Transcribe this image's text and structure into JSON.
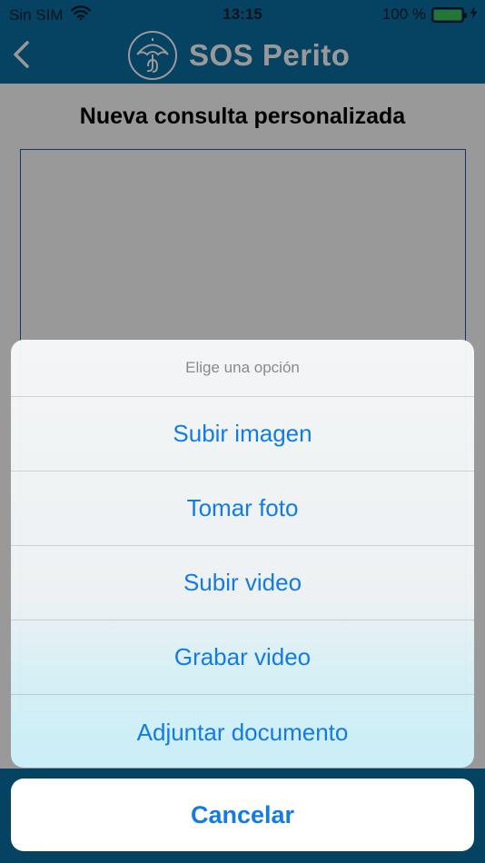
{
  "status_bar": {
    "carrier": "Sin SIM",
    "time": "13:15",
    "battery": "100 %",
    "battery_level": 1.0
  },
  "nav": {
    "title": "SOS Perito",
    "back_icon": "chevron-left-icon",
    "logo_icon": "umbrella-logo-icon"
  },
  "page": {
    "title": "Nueva consulta personalizada",
    "text_value": ""
  },
  "action_sheet": {
    "title": "Elige una opción",
    "options": [
      "Subir imagen",
      "Tomar foto",
      "Subir video",
      "Grabar video",
      "Adjuntar documento"
    ],
    "cancel_label": "Cancelar"
  },
  "colors": {
    "brand": "#0a6ea3",
    "action": "#127be6",
    "battery": "#3ec55a"
  }
}
